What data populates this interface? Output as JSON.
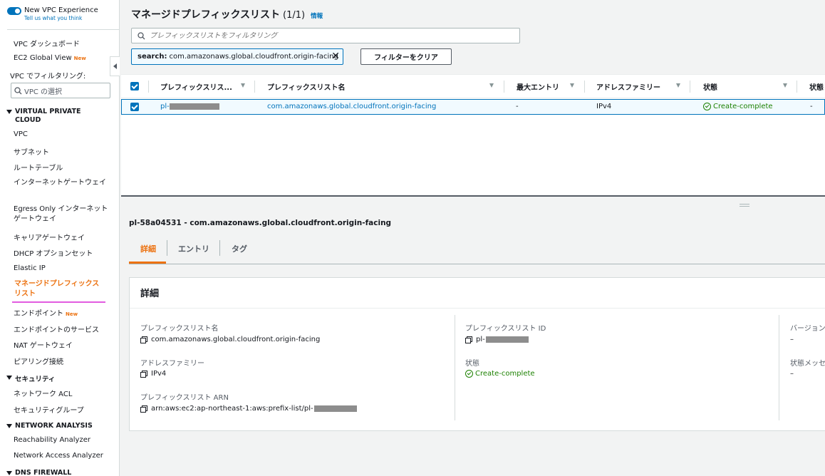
{
  "sidebar": {
    "toggle_title": "New VPC Experience",
    "toggle_link": "Tell us what you think",
    "dashboard": "VPC ダッシュボード",
    "ec2_global_view": "EC2 Global View",
    "new_badge": "New",
    "filter_label": "VPC でフィルタリング:",
    "vpc_select_placeholder": "VPC の選択",
    "section_vpc": "VIRTUAL PRIVATE CLOUD",
    "items_vpc": [
      "VPC",
      "サブネット",
      "ルートテーブル",
      "インターネットゲートウェイ",
      "Egress Only インターネットゲートウェイ",
      "キャリアゲートウェイ",
      "DHCP オプションセット",
      "Elastic IP",
      "マネージドプレフィックスリスト",
      "エンドポイント",
      "エンドポイントのサービス",
      "NAT ゲートウェイ",
      "ピアリング接続"
    ],
    "section_security": "セキュリティ",
    "items_security": [
      "ネットワーク ACL",
      "セキュリティグループ"
    ],
    "section_network": "NETWORK ANALYSIS",
    "items_network": [
      "Reachability Analyzer",
      "Network Access Analyzer"
    ],
    "section_dns": "DNS FIREWALL"
  },
  "header": {
    "title": "マネージドプレフィックスリスト",
    "count": "(1/1)",
    "info": "情報"
  },
  "search": {
    "placeholder": "プレフィックスリストをフィルタリング",
    "token_key": "search:",
    "token_value": "com.amazonaws.global.cloudfront.origin-facing",
    "clear_label": "フィルターをクリア"
  },
  "table": {
    "columns": [
      "プレフィックスリス...",
      "プレフィックスリスト名",
      "最大エントリ",
      "アドレスファミリー",
      "状態",
      "状態"
    ],
    "row": {
      "id_prefix": "pl-",
      "name": "com.amazonaws.global.cloudfront.origin-facing",
      "max_entries": "-",
      "family": "IPv4",
      "state": "Create-complete",
      "state_msg": "-"
    }
  },
  "detail": {
    "title": "pl-58a04531 - com.amazonaws.global.cloudfront.origin-facing",
    "tabs": [
      "詳細",
      "エントリ",
      "タグ"
    ],
    "panel_title": "詳細",
    "fields": {
      "name_label": "プレフィックスリスト名",
      "name_value": "com.amazonaws.global.cloudfront.origin-facing",
      "family_label": "アドレスファミリー",
      "family_value": "IPv4",
      "arn_label": "プレフィックスリスト ARN",
      "arn_value": "arn:aws:ec2:ap-northeast-1:aws:prefix-list/pl-",
      "id_label": "プレフィックスリスト ID",
      "id_value": "pl-",
      "state_label": "状態",
      "state_value": "Create-complete",
      "version_label": "バージョン",
      "version_value": "–",
      "state_msg_label": "状態メッセ",
      "state_msg_value": "–"
    }
  },
  "colors": {
    "accent": "#ec7211",
    "link": "#0073bb",
    "success": "#1d8102"
  }
}
